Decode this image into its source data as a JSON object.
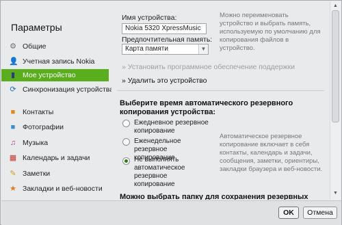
{
  "window": {
    "close_glyph": "✕"
  },
  "sidebar": {
    "title": "Параметры",
    "items": [
      {
        "label": "Общие",
        "icon": "gear-icon",
        "glyph": "⚙",
        "color": "#6b6f73"
      },
      {
        "label": "Учетная запись Nokia",
        "icon": "user-account-icon",
        "glyph": "👤",
        "color": "#4a4f55"
      },
      {
        "label": "Мое устройство",
        "icon": "phone-icon",
        "glyph": "▮",
        "color": "#2a3c7a",
        "active": true
      },
      {
        "label": "Синхронизация устройства",
        "icon": "sync-icon",
        "glyph": "⟳",
        "color": "#1f6fb8"
      },
      {
        "label": "Контакты",
        "icon": "contacts-icon",
        "glyph": "■",
        "color": "#e08a1e"
      },
      {
        "label": "Фотографии",
        "icon": "photos-icon",
        "glyph": "■",
        "color": "#3b8fd0"
      },
      {
        "label": "Музыка",
        "icon": "music-icon",
        "glyph": "♫",
        "color": "#b03a8c"
      },
      {
        "label": "Календарь и задачи",
        "icon": "calendar-icon",
        "glyph": "▦",
        "color": "#c0392b"
      },
      {
        "label": "Заметки",
        "icon": "notes-icon",
        "glyph": "✎",
        "color": "#d4a017"
      },
      {
        "label": "Закладки и веб-новости",
        "icon": "bookmarks-icon",
        "glyph": "★",
        "color": "#e07b1e"
      }
    ],
    "active_color": "#5aad1d"
  },
  "device": {
    "name_label": "Имя устройства:",
    "name_value": "Nokia 5320 XpressMusic",
    "name_hint": "Можно переименовать устройство и выбрать память, используемую по умолчанию для копирования файлов в устройство.",
    "memory_label": "Предпочтительная память:",
    "memory_value": "Карта памяти",
    "install_link": "» Установить программное обеспечение поддержки",
    "remove_link": "» Удалить это устройство"
  },
  "backup": {
    "title": "Выберите время автоматического резервного копирования устройства:",
    "options": [
      {
        "label": "Ежедневное резервное копирование",
        "checked": false
      },
      {
        "label": "Еженедельное резервное копирование",
        "checked": false
      },
      {
        "label": "Не выполнять автоматическое резервное копирование",
        "checked": true
      }
    ],
    "hint": "Автоматическое резервное копирование включает в себя контакты, календарь и задачи, сообщения, заметки, ориентиры, закладки браузера и веб-новости.",
    "folder_title": "Можно выбрать папку для сохранения резервных копий:"
  },
  "buttons": {
    "ok": "OK",
    "cancel": "Отмена"
  }
}
